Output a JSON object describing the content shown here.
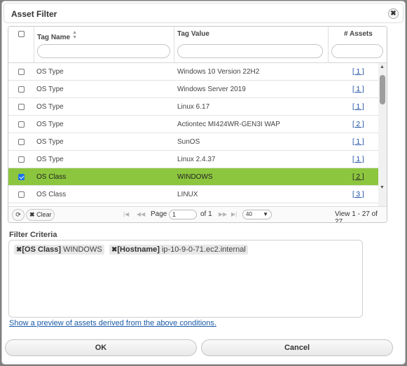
{
  "dialog": {
    "title": "Asset Filter",
    "close_glyph": "✖"
  },
  "grid": {
    "columns": {
      "name": "Tag Name",
      "value": "Tag Value",
      "assets": "# Assets"
    },
    "rows": [
      {
        "name": "OS Type",
        "value": "Windows 10 Version 22H2",
        "assets": "[ 1 ]",
        "checked": false
      },
      {
        "name": "OS Type",
        "value": "Windows Server 2019",
        "assets": "[ 1 ]",
        "checked": false
      },
      {
        "name": "OS Type",
        "value": "Linux 6.17",
        "assets": "[ 1 ]",
        "checked": false
      },
      {
        "name": "OS Type",
        "value": "Actiontec MI424WR-GEN3I WAP",
        "assets": "[ 2 ]",
        "checked": false
      },
      {
        "name": "OS Type",
        "value": "SunOS",
        "assets": "[ 1 ]",
        "checked": false
      },
      {
        "name": "OS Type",
        "value": "Linux 2.4.37",
        "assets": "[ 1 ]",
        "checked": false
      },
      {
        "name": "OS Class",
        "value": "WINDOWS",
        "assets": "[ 2 ]",
        "checked": true
      },
      {
        "name": "OS Class",
        "value": "LINUX",
        "assets": "[ 3 ]",
        "checked": false
      }
    ],
    "selected_color": "#8cc63f"
  },
  "pager": {
    "clear_label": "Clear",
    "page_label": "Page",
    "page_value": "1",
    "of_label": "of 1",
    "rows_per_page": "40",
    "view_text": "View 1 - 27 of 27"
  },
  "criteria": {
    "label": "Filter Criteria",
    "chips": [
      {
        "key": "[OS Class]",
        "value": "WINDOWS"
      },
      {
        "key": "[Hostname]",
        "value": "ip-10-9-0-71.ec2.internal"
      }
    ]
  },
  "preview_link": "Show a preview of assets derived from the above conditions.",
  "buttons": {
    "ok": "OK",
    "cancel": "Cancel"
  }
}
